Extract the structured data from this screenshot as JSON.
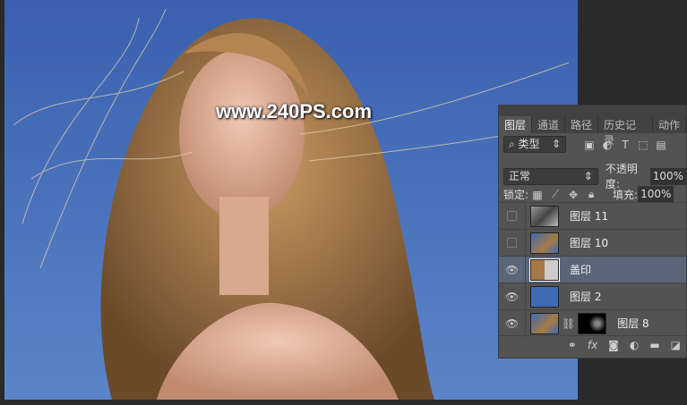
{
  "watermark": "www.240PS.com",
  "panel": {
    "tabs": [
      "图层",
      "通道",
      "路径",
      "历史记录",
      "动作"
    ],
    "filter": {
      "label": "类型",
      "icons": [
        "image-filter-icon",
        "adjustment-filter-icon",
        "type-filter-icon",
        "shape-filter-icon",
        "smart-object-filter-icon"
      ]
    },
    "blend_mode": "正常",
    "opacity_label": "不透明度:",
    "opacity": "100%",
    "lock_label": "锁定:",
    "fill_label": "填充:",
    "fill": "100%",
    "layers": [
      {
        "name": "图层 11",
        "visible": false
      },
      {
        "name": "图层 10",
        "visible": false
      },
      {
        "name": "盖印",
        "visible": true,
        "selected": true
      },
      {
        "name": "图层 2",
        "visible": true
      },
      {
        "name": "图层 8",
        "visible": true,
        "mask": true
      }
    ],
    "footer_icons": [
      "link-icon",
      "fx-icon",
      "mask-icon",
      "adjustment-icon",
      "folder-icon",
      "new-layer-icon"
    ],
    "fx_label": "fx"
  },
  "colors": {
    "sky": "#3f6bb4",
    "selected_layer": "#5b6579",
    "panel": "#535353"
  }
}
